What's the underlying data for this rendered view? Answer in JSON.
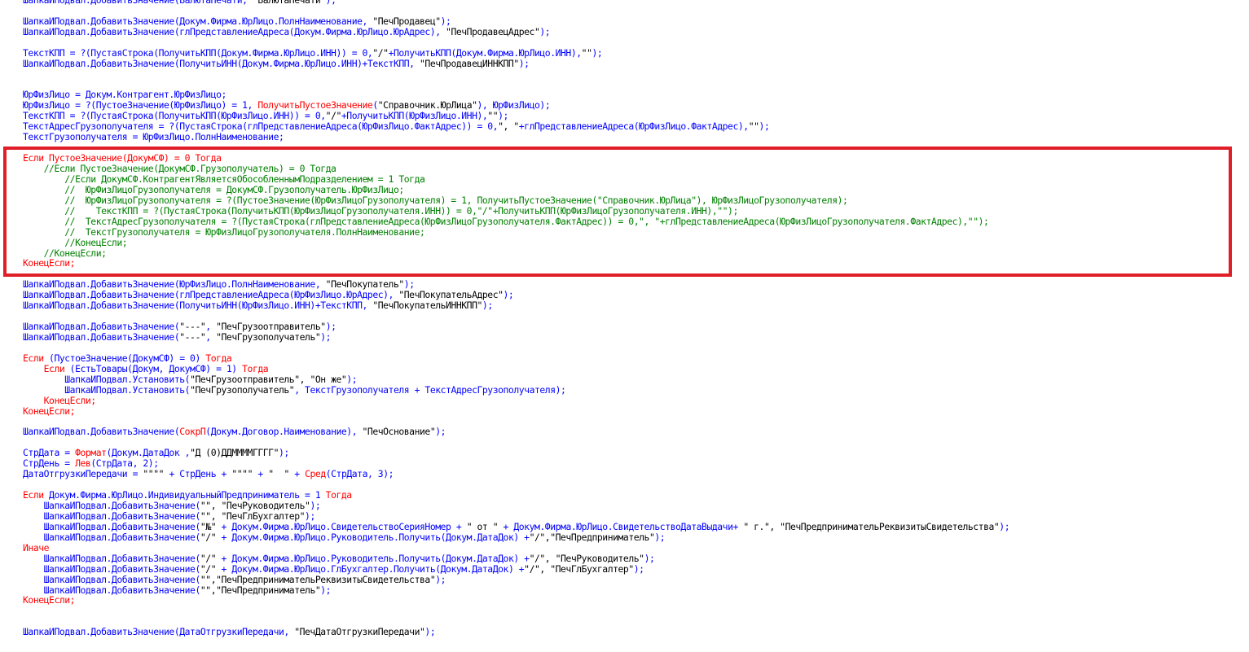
{
  "editor": {
    "lines": [
      [
        {
          "t": "ШапкаИПодвал.ДобавитьЗначение(ВалютаПечати, ",
          "c": "id"
        },
        {
          "t": "\"ВалютаПечати\"",
          "c": "pl"
        },
        {
          "t": ");",
          "c": "id"
        }
      ],
      [],
      [
        {
          "t": "ШапкаИПодвал.ДобавитьЗначение(Докум.Фирма.ЮрЛицо.ПолнНаименование, ",
          "c": "id"
        },
        {
          "t": "\"ПечПродавец\"",
          "c": "pl"
        },
        {
          "t": ");",
          "c": "id"
        }
      ],
      [
        {
          "t": "ШапкаИПодвал.ДобавитьЗначение(глПредставлениеАдреса(Докум.Фирма.ЮрЛицо.ЮрАдрес), ",
          "c": "id"
        },
        {
          "t": "\"ПечПродавецАдрес\"",
          "c": "pl"
        },
        {
          "t": ");",
          "c": "id"
        }
      ],
      [],
      [
        {
          "t": "ТекстКПП = ?(ПустаяСтрока(ПолучитьКПП(Докум.Фирма.ЮрЛицо.ИНН)) = 0,",
          "c": "id"
        },
        {
          "t": "\"/\"",
          "c": "pl"
        },
        {
          "t": "+ПолучитьКПП(Докум.Фирма.ЮрЛицо.ИНН),",
          "c": "id"
        },
        {
          "t": "\"\"",
          "c": "pl"
        },
        {
          "t": ");",
          "c": "id"
        }
      ],
      [
        {
          "t": "ШапкаИПодвал.ДобавитьЗначение(ПолучитьИНН(Докум.Фирма.ЮрЛицо.ИНН)+ТекстКПП, ",
          "c": "id"
        },
        {
          "t": "\"ПечПродавецИННКПП\"",
          "c": "pl"
        },
        {
          "t": ");",
          "c": "id"
        }
      ],
      [],
      [],
      [
        {
          "t": "ЮрФизЛицо = Докум.Контрагент.ЮрФизЛицо;",
          "c": "id"
        }
      ],
      [
        {
          "t": "ЮрФизЛицо = ?(ПустоеЗначение(ЮрФизЛицо) = 1, ",
          "c": "id"
        },
        {
          "t": "ПолучитьПустоеЗначение",
          "c": "kw"
        },
        {
          "t": "(",
          "c": "id"
        },
        {
          "t": "\"Справочник.ЮрЛица\"",
          "c": "pl"
        },
        {
          "t": "), ЮрФизЛицо);",
          "c": "id"
        }
      ],
      [
        {
          "t": "ТекстКПП = ?(ПустаяСтрока(ПолучитьКПП(ЮрФизЛицо.ИНН)) = 0,",
          "c": "id"
        },
        {
          "t": "\"/\"",
          "c": "pl"
        },
        {
          "t": "+ПолучитьКПП(ЮрФизЛицо.ИНН),",
          "c": "id"
        },
        {
          "t": "\"\"",
          "c": "pl"
        },
        {
          "t": ");",
          "c": "id"
        }
      ],
      [
        {
          "t": "ТекстАдресГрузополучателя = ?(ПустаяСтрока(глПредставлениеАдреса(ЮрФизЛицо.ФактАдрес)) = 0,",
          "c": "id"
        },
        {
          "t": "\", \"",
          "c": "pl"
        },
        {
          "t": "+глПредставлениеАдреса(ЮрФизЛицо.ФактАдрес),",
          "c": "id"
        },
        {
          "t": "\"\"",
          "c": "pl"
        },
        {
          "t": ");",
          "c": "id"
        }
      ],
      [
        {
          "t": "ТекстГрузополучателя = ЮрФизЛицо.ПолнНаименование;",
          "c": "id"
        }
      ],
      [],
      [
        {
          "t": "Если ПустоеЗначение(ДокумСФ) = 0 Тогда",
          "c": "kw"
        }
      ],
      [
        {
          "t": "    //Если ПустоеЗначение(ДокумСФ.Грузополучатель) = 0 Тогда",
          "c": "cm"
        }
      ],
      [
        {
          "t": "        //Если ДокумСФ.КонтрагентЯвляетсяОбособленнымПодразделением = 1 Тогда",
          "c": "cm"
        }
      ],
      [
        {
          "t": "        //  ЮрФизЛицоГрузополучателя = ДокумСФ.Грузополучатель.ЮрФизЛицо;",
          "c": "cm"
        }
      ],
      [
        {
          "t": "        //  ЮрФизЛицоГрузополучателя = ?(ПустоеЗначение(ЮрФизЛицоГрузополучателя) = 1, ПолучитьПустоеЗначение(\"Справочник.ЮрЛица\"), ЮрФизЛицоГрузополучателя);",
          "c": "cm"
        }
      ],
      [
        {
          "t": "        //    ТекстКПП = ?(ПустаяСтрока(ПолучитьКПП(ЮрФизЛицоГрузополучателя.ИНН)) = 0,\"/\"+ПолучитьКПП(ЮрФизЛицоГрузополучателя.ИНН),\"\");",
          "c": "cm"
        }
      ],
      [
        {
          "t": "        //  ТекстАдресГрузополучателя = ?(ПустаяСтрока(глПредставлениеАдреса(ЮрФизЛицоГрузополучателя.ФактАдрес)) = 0,\", \"+глПредставлениеАдреса(ЮрФизЛицоГрузополучателя.ФактАдрес),\"\");",
          "c": "cm"
        }
      ],
      [
        {
          "t": "        //  ТекстГрузополучателя = ЮрФизЛицоГрузополучателя.ПолнНаименование;",
          "c": "cm"
        }
      ],
      [
        {
          "t": "        //КонецЕсли;",
          "c": "cm"
        }
      ],
      [
        {
          "t": "    //КонецЕсли;",
          "c": "cm"
        }
      ],
      [
        {
          "t": "КонецЕсли;",
          "c": "kw"
        }
      ],
      [],
      [
        {
          "t": "ШапкаИПодвал.ДобавитьЗначение(ЮрФизЛицо.ПолнНаименование, ",
          "c": "id"
        },
        {
          "t": "\"ПечПокупатель\"",
          "c": "pl"
        },
        {
          "t": ");",
          "c": "id"
        }
      ],
      [
        {
          "t": "ШапкаИПодвал.ДобавитьЗначение(глПредставлениеАдреса(ЮрФизЛицо.ЮрАдрес), ",
          "c": "id"
        },
        {
          "t": "\"ПечПокупательАдрес\"",
          "c": "pl"
        },
        {
          "t": ");",
          "c": "id"
        }
      ],
      [
        {
          "t": "ШапкаИПодвал.ДобавитьЗначение(ПолучитьИНН(ЮрФизЛицо.ИНН)+ТекстКПП, ",
          "c": "id"
        },
        {
          "t": "\"ПечПокупательИННКПП\"",
          "c": "pl"
        },
        {
          "t": ");",
          "c": "id"
        }
      ],
      [],
      [
        {
          "t": "ШапкаИПодвал.ДобавитьЗначение(",
          "c": "id"
        },
        {
          "t": "\"---\"",
          "c": "pl"
        },
        {
          "t": ", ",
          "c": "id"
        },
        {
          "t": "\"ПечГрузоотправитель\"",
          "c": "pl"
        },
        {
          "t": ");",
          "c": "id"
        }
      ],
      [
        {
          "t": "ШапкаИПодвал.ДобавитьЗначение(",
          "c": "id"
        },
        {
          "t": "\"---\"",
          "c": "pl"
        },
        {
          "t": ", ",
          "c": "id"
        },
        {
          "t": "\"ПечГрузополучатель\"",
          "c": "pl"
        },
        {
          "t": ");",
          "c": "id"
        }
      ],
      [],
      [
        {
          "t": "Если ",
          "c": "kw"
        },
        {
          "t": "(ПустоеЗначение(ДокумСФ) = 0) ",
          "c": "id"
        },
        {
          "t": "Тогда",
          "c": "kw"
        }
      ],
      [
        {
          "t": "    Если ",
          "c": "kw"
        },
        {
          "t": "(ЕстьТовары(Докум, ДокумСФ) = 1) ",
          "c": "id"
        },
        {
          "t": "Тогда",
          "c": "kw"
        }
      ],
      [
        {
          "t": "        ШапкаИПодвал.Установить(",
          "c": "id"
        },
        {
          "t": "\"ПечГрузоотправитель\", \"Он же\"",
          "c": "pl"
        },
        {
          "t": ");",
          "c": "id"
        }
      ],
      [
        {
          "t": "        ШапкаИПодвал.Установить(",
          "c": "id"
        },
        {
          "t": "\"ПечГрузополучатель\"",
          "c": "pl"
        },
        {
          "t": ", ТекстГрузополучателя + ТекстАдресГрузополучателя);",
          "c": "id"
        }
      ],
      [
        {
          "t": "    КонецЕсли;",
          "c": "kw"
        }
      ],
      [
        {
          "t": "КонецЕсли;",
          "c": "kw"
        }
      ],
      [],
      [
        {
          "t": "ШапкаИПодвал.ДобавитьЗначение(",
          "c": "id"
        },
        {
          "t": "СокрП",
          "c": "kw"
        },
        {
          "t": "(Докум.Договор.Наименование), ",
          "c": "id"
        },
        {
          "t": "\"ПечОснование\"",
          "c": "pl"
        },
        {
          "t": ");",
          "c": "id"
        }
      ],
      [],
      [
        {
          "t": "СтрДата = ",
          "c": "id"
        },
        {
          "t": "Формат",
          "c": "kw"
        },
        {
          "t": "(Докум.ДатаДок ,",
          "c": "id"
        },
        {
          "t": "\"Д (0)ДДММММГГГГ\"",
          "c": "pl"
        },
        {
          "t": ");",
          "c": "id"
        }
      ],
      [
        {
          "t": "СтрДень = ",
          "c": "id"
        },
        {
          "t": "Лев",
          "c": "kw"
        },
        {
          "t": "(СтрДата, 2);",
          "c": "id"
        }
      ],
      [
        {
          "t": "ДатаОтгрузкиПередачи = ",
          "c": "id"
        },
        {
          "t": "\"\"\"\"",
          "c": "pl"
        },
        {
          "t": " + СтрДень + ",
          "c": "id"
        },
        {
          "t": "\"\"\"\"",
          "c": "pl"
        },
        {
          "t": " + ",
          "c": "id"
        },
        {
          "t": "\"  \"",
          "c": "pl"
        },
        {
          "t": " + ",
          "c": "id"
        },
        {
          "t": "Сред",
          "c": "kw"
        },
        {
          "t": "(СтрДата, 3);",
          "c": "id"
        }
      ],
      [],
      [
        {
          "t": "Если ",
          "c": "kw"
        },
        {
          "t": "Докум.Фирма.ЮрЛицо.ИндивидуальныйПредприниматель = 1 ",
          "c": "id"
        },
        {
          "t": "Тогда",
          "c": "kw"
        }
      ],
      [
        {
          "t": "    ШапкаИПодвал.ДобавитьЗначение(",
          "c": "id"
        },
        {
          "t": "\"\", \"ПечРуководитель\"",
          "c": "pl"
        },
        {
          "t": ");",
          "c": "id"
        }
      ],
      [
        {
          "t": "    ШапкаИПодвал.ДобавитьЗначение(",
          "c": "id"
        },
        {
          "t": "\"\", \"ПечГлБухгалтер\"",
          "c": "pl"
        },
        {
          "t": ");",
          "c": "id"
        }
      ],
      [
        {
          "t": "    ШапкаИПодвал.ДобавитьЗначение(",
          "c": "id"
        },
        {
          "t": "\"№\"",
          "c": "pl"
        },
        {
          "t": " + Докум.Фирма.ЮрЛицо.СвидетельствоСерияНомер + ",
          "c": "id"
        },
        {
          "t": "\" от \"",
          "c": "pl"
        },
        {
          "t": " + Докум.Фирма.ЮрЛицо.СвидетельствоДатаВыдачи+ ",
          "c": "id"
        },
        {
          "t": "\" г.\", \"ПечПредпринимательРеквизитыСвидетельства\"",
          "c": "pl"
        },
        {
          "t": ");",
          "c": "id"
        }
      ],
      [
        {
          "t": "    ШапкаИПодвал.ДобавитьЗначение(",
          "c": "id"
        },
        {
          "t": "\"/\"",
          "c": "pl"
        },
        {
          "t": " + Докум.Фирма.ЮрЛицо.Руководитель.Получить(Докум.ДатаДок) +",
          "c": "id"
        },
        {
          "t": "\"/\",\"ПечПредприниматель\"",
          "c": "pl"
        },
        {
          "t": ");",
          "c": "id"
        }
      ],
      [
        {
          "t": "Иначе",
          "c": "kw"
        }
      ],
      [
        {
          "t": "    ШапкаИПодвал.ДобавитьЗначение(",
          "c": "id"
        },
        {
          "t": "\"/\"",
          "c": "pl"
        },
        {
          "t": " + Докум.Фирма.ЮрЛицо.Руководитель.Получить(Докум.ДатаДок) +",
          "c": "id"
        },
        {
          "t": "\"/\", \"ПечРуководитель\"",
          "c": "pl"
        },
        {
          "t": ");",
          "c": "id"
        }
      ],
      [
        {
          "t": "    ШапкаИПодвал.ДобавитьЗначение(",
          "c": "id"
        },
        {
          "t": "\"/\"",
          "c": "pl"
        },
        {
          "t": " + Докум.Фирма.ЮрЛицо.ГлБухгалтер.Получить(Докум.ДатаДок) +",
          "c": "id"
        },
        {
          "t": "\"/\", \"ПечГлБухгалтер\"",
          "c": "pl"
        },
        {
          "t": ");",
          "c": "id"
        }
      ],
      [
        {
          "t": "    ШапкаИПодвал.ДобавитьЗначение(",
          "c": "id"
        },
        {
          "t": "\"\",\"ПечПредпринимательРеквизитыСвидетельства\"",
          "c": "pl"
        },
        {
          "t": ");",
          "c": "id"
        }
      ],
      [
        {
          "t": "    ШапкаИПодвал.ДобавитьЗначение(",
          "c": "id"
        },
        {
          "t": "\"\",\"ПечПредприниматель\"",
          "c": "pl"
        },
        {
          "t": ");",
          "c": "id"
        }
      ],
      [
        {
          "t": "КонецЕсли;",
          "c": "kw"
        }
      ],
      [],
      [],
      [
        {
          "t": "ШапкаИПодвал.ДобавитьЗначение(ДатаОтгрузкиПередачи, ",
          "c": "id"
        },
        {
          "t": "\"ПечДатаОтгрузкиПередачи\"",
          "c": "pl"
        },
        {
          "t": ");",
          "c": "id"
        }
      ]
    ]
  },
  "colors": {
    "identifier": "#0000ff",
    "keyword": "#ff0000",
    "comment": "#008000",
    "string": "#000000",
    "highlight_border": "#e01e28"
  }
}
